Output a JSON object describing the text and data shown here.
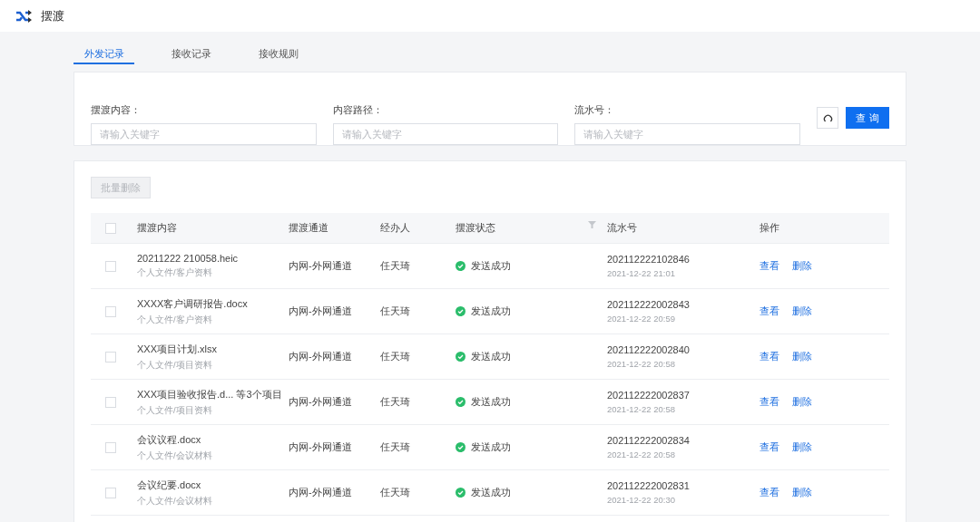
{
  "header": {
    "title": "摆渡"
  },
  "tabs": [
    {
      "label": "外发记录",
      "selected": true
    },
    {
      "label": "接收记录",
      "selected": false
    },
    {
      "label": "接收规则",
      "selected": false
    }
  ],
  "filters": [
    {
      "label": "摆渡内容：",
      "placeholder": "请输入关键字"
    },
    {
      "label": "内容路径：",
      "placeholder": "请输入关键字"
    },
    {
      "label": "流水号：",
      "placeholder": "请输入关键字"
    }
  ],
  "search_button": "查 询",
  "batch_delete": {
    "label": "批量删除",
    "disabled": true
  },
  "table": {
    "select_all_checked": false,
    "columns": [
      "摆渡内容",
      "摆渡通道",
      "经办人",
      "摆渡状态",
      "流水号",
      "操作"
    ],
    "rows": [
      {
        "checked": false,
        "name": "20211222 210058.heic",
        "path": "个人文件/客户资料",
        "channel": "内网-外网通道",
        "handler": "任天琦",
        "status": {
          "kind": "success",
          "label": "发送成功"
        },
        "serial": "202112222102846",
        "time": "2021-12-22 21:01",
        "actions": [
          "查看",
          "删除"
        ]
      },
      {
        "checked": false,
        "name": "XXXX客户调研报告.docx",
        "path": "个人文件/客户资料",
        "channel": "内网-外网通道",
        "handler": "任天琦",
        "status": {
          "kind": "success",
          "label": "发送成功"
        },
        "serial": "202112222002843",
        "time": "2021-12-22 20:59",
        "actions": [
          "查看",
          "删除"
        ]
      },
      {
        "checked": false,
        "name": "XXX项目计划.xlsx",
        "path": "个人文件/项目资料",
        "channel": "内网-外网通道",
        "handler": "任天琦",
        "status": {
          "kind": "success",
          "label": "发送成功"
        },
        "serial": "202112222002840",
        "time": "2021-12-22 20:58",
        "actions": [
          "查看",
          "删除"
        ]
      },
      {
        "checked": false,
        "name": "XXX项目验收报告.d... 等3个项目",
        "path": "个人文件/项目资料",
        "channel": "内网-外网通道",
        "handler": "任天琦",
        "status": {
          "kind": "success",
          "label": "发送成功"
        },
        "serial": "202112222002837",
        "time": "2021-12-22 20:58",
        "actions": [
          "查看",
          "删除"
        ]
      },
      {
        "checked": false,
        "name": "会议议程.docx",
        "path": "个人文件/会议材料",
        "channel": "内网-外网通道",
        "handler": "任天琦",
        "status": {
          "kind": "success",
          "label": "发送成功"
        },
        "serial": "202112222002834",
        "time": "2021-12-22 20:58",
        "actions": [
          "查看",
          "删除"
        ]
      },
      {
        "checked": false,
        "name": "会议纪要.docx",
        "path": "个人文件/会议材料",
        "channel": "内网-外网通道",
        "handler": "任天琦",
        "status": {
          "kind": "success",
          "label": "发送成功"
        },
        "serial": "202112222002831",
        "time": "2021-12-22 20:30",
        "actions": [
          "查看",
          "删除"
        ]
      }
    ]
  }
}
